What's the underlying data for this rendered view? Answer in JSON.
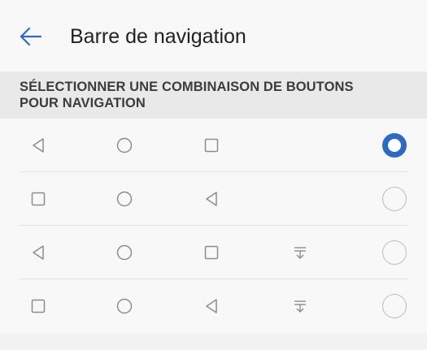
{
  "header": {
    "title": "Barre de navigation",
    "back_icon": "arrow-left-icon",
    "accent_color": "#2f6ac0"
  },
  "section": {
    "title": "SÉLECTIONNER UNE COMBINAISON DE BOUTONS POUR NAVIGATION"
  },
  "options": [
    {
      "buttons": [
        "back-triangle-icon",
        "home-circle-icon",
        "recents-square-icon"
      ],
      "selected": true
    },
    {
      "buttons": [
        "recents-square-icon",
        "home-circle-icon",
        "back-triangle-icon"
      ],
      "selected": false
    },
    {
      "buttons": [
        "back-triangle-icon",
        "home-circle-icon",
        "recents-square-icon",
        "notification-pull-down-icon"
      ],
      "selected": false
    },
    {
      "buttons": [
        "recents-square-icon",
        "home-circle-icon",
        "back-triangle-icon",
        "notification-pull-down-icon"
      ],
      "selected": false
    }
  ],
  "colors": {
    "radio_selected": "#2f6ac0",
    "radio_unselected": "#bdbdbd",
    "icon": "#8c8c8c"
  }
}
